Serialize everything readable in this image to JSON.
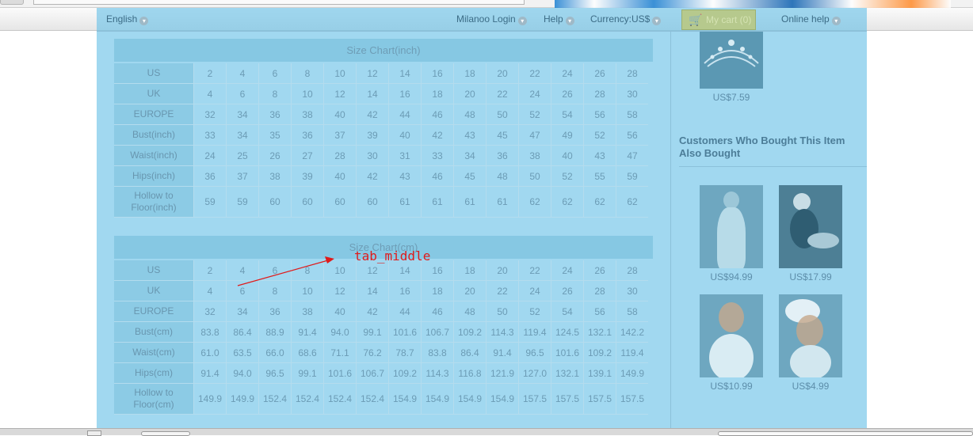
{
  "nav": {
    "language": "English",
    "login": "Milanoo Login",
    "help": "Help",
    "currency": "Currency:US$",
    "cart": "My cart (0)",
    "online_help": "Online help"
  },
  "chart_inch": {
    "title": "Size Chart(inch)",
    "rows": [
      {
        "label": "US",
        "values": [
          "2",
          "4",
          "6",
          "8",
          "10",
          "12",
          "14",
          "16",
          "18",
          "20",
          "22",
          "24",
          "26",
          "28"
        ]
      },
      {
        "label": "UK",
        "values": [
          "4",
          "6",
          "8",
          "10",
          "12",
          "14",
          "16",
          "18",
          "20",
          "22",
          "24",
          "26",
          "28",
          "30"
        ]
      },
      {
        "label": "EUROPE",
        "values": [
          "32",
          "34",
          "36",
          "38",
          "40",
          "42",
          "44",
          "46",
          "48",
          "50",
          "52",
          "54",
          "56",
          "58"
        ]
      },
      {
        "label": "Bust(inch)",
        "values": [
          "33",
          "34",
          "35",
          "36",
          "37",
          "39",
          "40",
          "42",
          "43",
          "45",
          "47",
          "49",
          "52",
          "56"
        ]
      },
      {
        "label": "Waist(inch)",
        "values": [
          "24",
          "25",
          "26",
          "27",
          "28",
          "30",
          "31",
          "33",
          "34",
          "36",
          "38",
          "40",
          "43",
          "47"
        ]
      },
      {
        "label": "Hips(inch)",
        "values": [
          "36",
          "37",
          "38",
          "39",
          "40",
          "42",
          "43",
          "46",
          "45",
          "48",
          "50",
          "52",
          "55",
          "59"
        ]
      },
      {
        "label": "Hollow to Floor(inch)",
        "values": [
          "59",
          "59",
          "60",
          "60",
          "60",
          "60",
          "61",
          "61",
          "61",
          "61",
          "62",
          "62",
          "62",
          "62"
        ],
        "tall": true
      }
    ]
  },
  "chart_cm": {
    "title": "Size Chart(cm)",
    "rows": [
      {
        "label": "US",
        "values": [
          "2",
          "4",
          "6",
          "8",
          "10",
          "12",
          "14",
          "16",
          "18",
          "20",
          "22",
          "24",
          "26",
          "28"
        ]
      },
      {
        "label": "UK",
        "values": [
          "4",
          "6",
          "8",
          "10",
          "12",
          "14",
          "16",
          "18",
          "20",
          "22",
          "24",
          "26",
          "28",
          "30"
        ]
      },
      {
        "label": "EUROPE",
        "values": [
          "32",
          "34",
          "36",
          "38",
          "40",
          "42",
          "44",
          "46",
          "48",
          "50",
          "52",
          "54",
          "56",
          "58"
        ]
      },
      {
        "label": "Bust(cm)",
        "values": [
          "83.8",
          "86.4",
          "88.9",
          "91.4",
          "94.0",
          "99.1",
          "101.6",
          "106.7",
          "109.2",
          "114.3",
          "119.4",
          "124.5",
          "132.1",
          "142.2"
        ]
      },
      {
        "label": "Waist(cm)",
        "values": [
          "61.0",
          "63.5",
          "66.0",
          "68.6",
          "71.1",
          "76.2",
          "78.7",
          "83.8",
          "86.4",
          "91.4",
          "96.5",
          "101.6",
          "109.2",
          "119.4"
        ]
      },
      {
        "label": "Hips(cm)",
        "values": [
          "91.4",
          "94.0",
          "96.5",
          "99.1",
          "101.6",
          "106.7",
          "109.2",
          "114.3",
          "116.8",
          "121.9",
          "127.0",
          "132.1",
          "139.1",
          "149.9"
        ]
      },
      {
        "label": "Hollow to Floor(cm)",
        "values": [
          "149.9",
          "149.9",
          "152.4",
          "152.4",
          "152.4",
          "152.4",
          "154.9",
          "154.9",
          "154.9",
          "154.9",
          "157.5",
          "157.5",
          "157.5",
          "157.5"
        ],
        "tall": true
      }
    ]
  },
  "sidebar": {
    "top_price": "US$7.59",
    "heading": "Customers Who Bought This Item Also Bought",
    "products": [
      {
        "price": "US$94.99"
      },
      {
        "price": "US$17.99"
      },
      {
        "price": "US$10.99"
      },
      {
        "price": "US$4.99"
      }
    ]
  },
  "annotation": {
    "label": "tab_middle",
    "color": "#e01a1a"
  },
  "colors": {
    "overlay": "#68c0e6",
    "annotation": "#e01a1a"
  }
}
